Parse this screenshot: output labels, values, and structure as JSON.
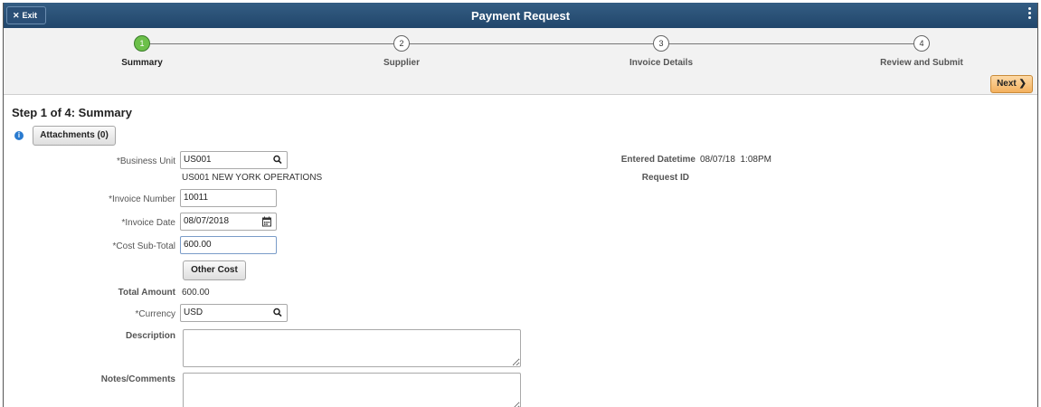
{
  "header": {
    "exit_label": "Exit",
    "title": "Payment Request"
  },
  "train": {
    "steps": [
      {
        "number": "1",
        "label": "Summary",
        "active": true
      },
      {
        "number": "2",
        "label": "Supplier",
        "active": false
      },
      {
        "number": "3",
        "label": "Invoice Details",
        "active": false
      },
      {
        "number": "4",
        "label": "Review and Submit",
        "active": false
      }
    ],
    "next_label": "Next"
  },
  "page": {
    "step_title": "Step 1 of 4: Summary",
    "attachments_label": "Attachments (0)"
  },
  "form": {
    "business_unit": {
      "label": "*Business Unit",
      "value": "US001",
      "description": "US001 NEW YORK OPERATIONS"
    },
    "invoice_number": {
      "label": "*Invoice Number",
      "value": "10011"
    },
    "invoice_date": {
      "label": "*Invoice Date",
      "value": "08/07/2018"
    },
    "cost_subtotal": {
      "label": "*Cost Sub-Total",
      "value": "600.00"
    },
    "other_cost_label": "Other Cost",
    "total_amount": {
      "label": "Total Amount",
      "value": "600.00"
    },
    "currency": {
      "label": "*Currency",
      "value": "USD"
    },
    "description": {
      "label": "Description",
      "value": ""
    },
    "notes": {
      "label": "Notes/Comments",
      "value": ""
    },
    "entered_datetime": {
      "label": "Entered Datetime",
      "value": "08/07/18  1:08PM"
    },
    "request_id": {
      "label": "Request ID",
      "value": ""
    }
  }
}
